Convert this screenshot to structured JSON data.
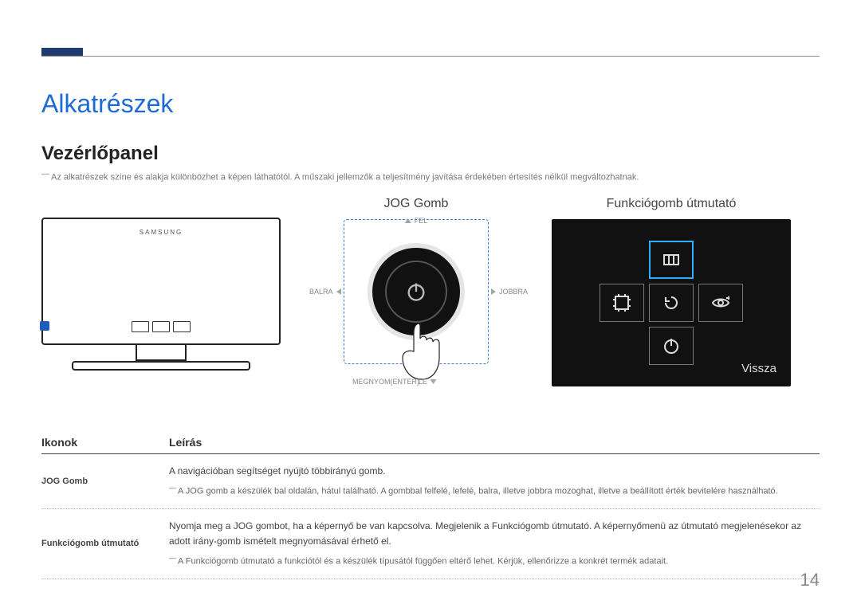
{
  "page_number": "14",
  "section_title": "Alkatrészek",
  "subsection_title": "Vezérlőpanel",
  "note_text": "Az alkatrészek színe és alakja különbözhet a képen láthatótól. A műszaki jellemzők a teljesítmény javítása érdekében értesítés nélkül megváltozhatnak.",
  "monitor_brand": "SAMSUNG",
  "jog": {
    "title": "JOG Gomb",
    "up": "FEL",
    "down": "LE",
    "left": "BALRA",
    "right": "JOBBRA",
    "enter": "MEGNYOM(ENTER)"
  },
  "guide": {
    "title": "Funkciógomb útmutató",
    "back_label": "Vissza"
  },
  "table": {
    "head_icons": "Ikonok",
    "head_desc": "Leírás",
    "rows": [
      {
        "name": "JOG Gomb",
        "desc_main": "A navigációban segítséget nyújtó többirányú gomb.",
        "desc_sub": "A JOG gomb a készülék bal oldalán, hátul található. A gombbal felfelé, lefelé, balra, illetve jobbra mozoghat, illetve a beállított érték bevitelére használható."
      },
      {
        "name": "Funkciógomb útmutató",
        "desc_main": "Nyomja meg a JOG gombot, ha a képernyő be van kapcsolva. Megjelenik a Funkciógomb útmutató. A képernyőmenü az útmutató megjelenésekor az adott irány-gomb ismételt megnyomásával érhető el.",
        "desc_sub": "A Funkciógomb útmutató a funkciótól és a készülék típusától függően eltérő lehet. Kérjük, ellenőrizze a konkrét termék adatait."
      }
    ]
  }
}
